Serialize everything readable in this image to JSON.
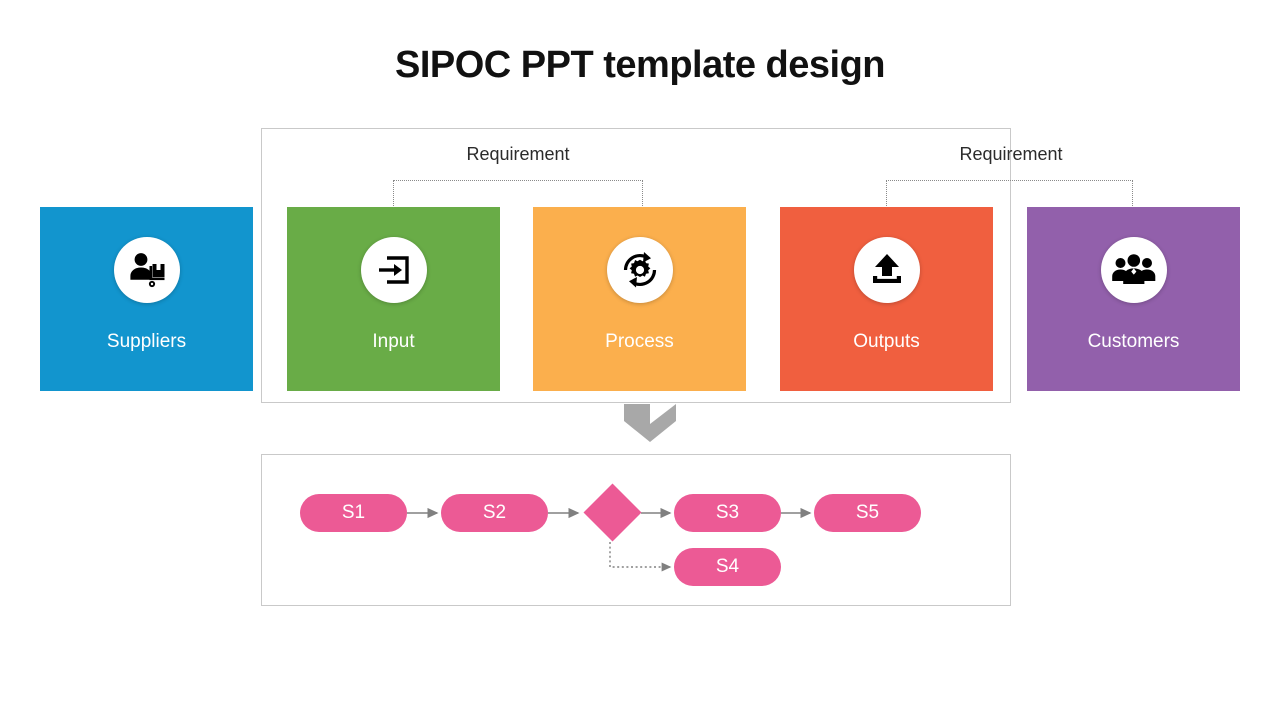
{
  "title": "SIPOC PPT template design",
  "colors": {
    "suppliers": "#1295ce",
    "input": "#69ac47",
    "process": "#fbaf4d",
    "outputs": "#f05f3f",
    "customers": "#9260ab",
    "flow_node": "#ec5a95",
    "frame_border": "#c9c9c9",
    "connector": "#8a8a8a",
    "chevron": "#a8a8a8"
  },
  "sipoc": {
    "boxes": [
      {
        "key": "suppliers",
        "label": "Suppliers",
        "icon": "supplier-person-package-icon"
      },
      {
        "key": "input",
        "label": "Input",
        "icon": "arrow-into-box-icon"
      },
      {
        "key": "process",
        "label": "Process",
        "icon": "gear-cycle-icon"
      },
      {
        "key": "outputs",
        "label": "Outputs",
        "icon": "upload-tray-icon"
      },
      {
        "key": "customers",
        "label": "Customers",
        "icon": "people-group-icon"
      }
    ],
    "requirements": [
      {
        "label": "Requirement"
      },
      {
        "label": "Requirement"
      }
    ],
    "section_connector_icon": "down-chevron-icon"
  },
  "flow": {
    "nodes": [
      {
        "id": "s1",
        "label": "S1",
        "shape": "pill"
      },
      {
        "id": "s2",
        "label": "S2",
        "shape": "pill"
      },
      {
        "id": "decision",
        "label": "",
        "shape": "diamond"
      },
      {
        "id": "s3",
        "label": "S3",
        "shape": "pill"
      },
      {
        "id": "s5",
        "label": "S5",
        "shape": "pill"
      },
      {
        "id": "s4",
        "label": "S4",
        "shape": "pill"
      }
    ],
    "edges": [
      {
        "from": "s1",
        "to": "s2",
        "style": "solid"
      },
      {
        "from": "s2",
        "to": "decision",
        "style": "solid"
      },
      {
        "from": "decision",
        "to": "s3",
        "style": "solid"
      },
      {
        "from": "s3",
        "to": "s5",
        "style": "solid"
      },
      {
        "from": "decision",
        "to": "s4",
        "style": "dotted"
      }
    ]
  }
}
